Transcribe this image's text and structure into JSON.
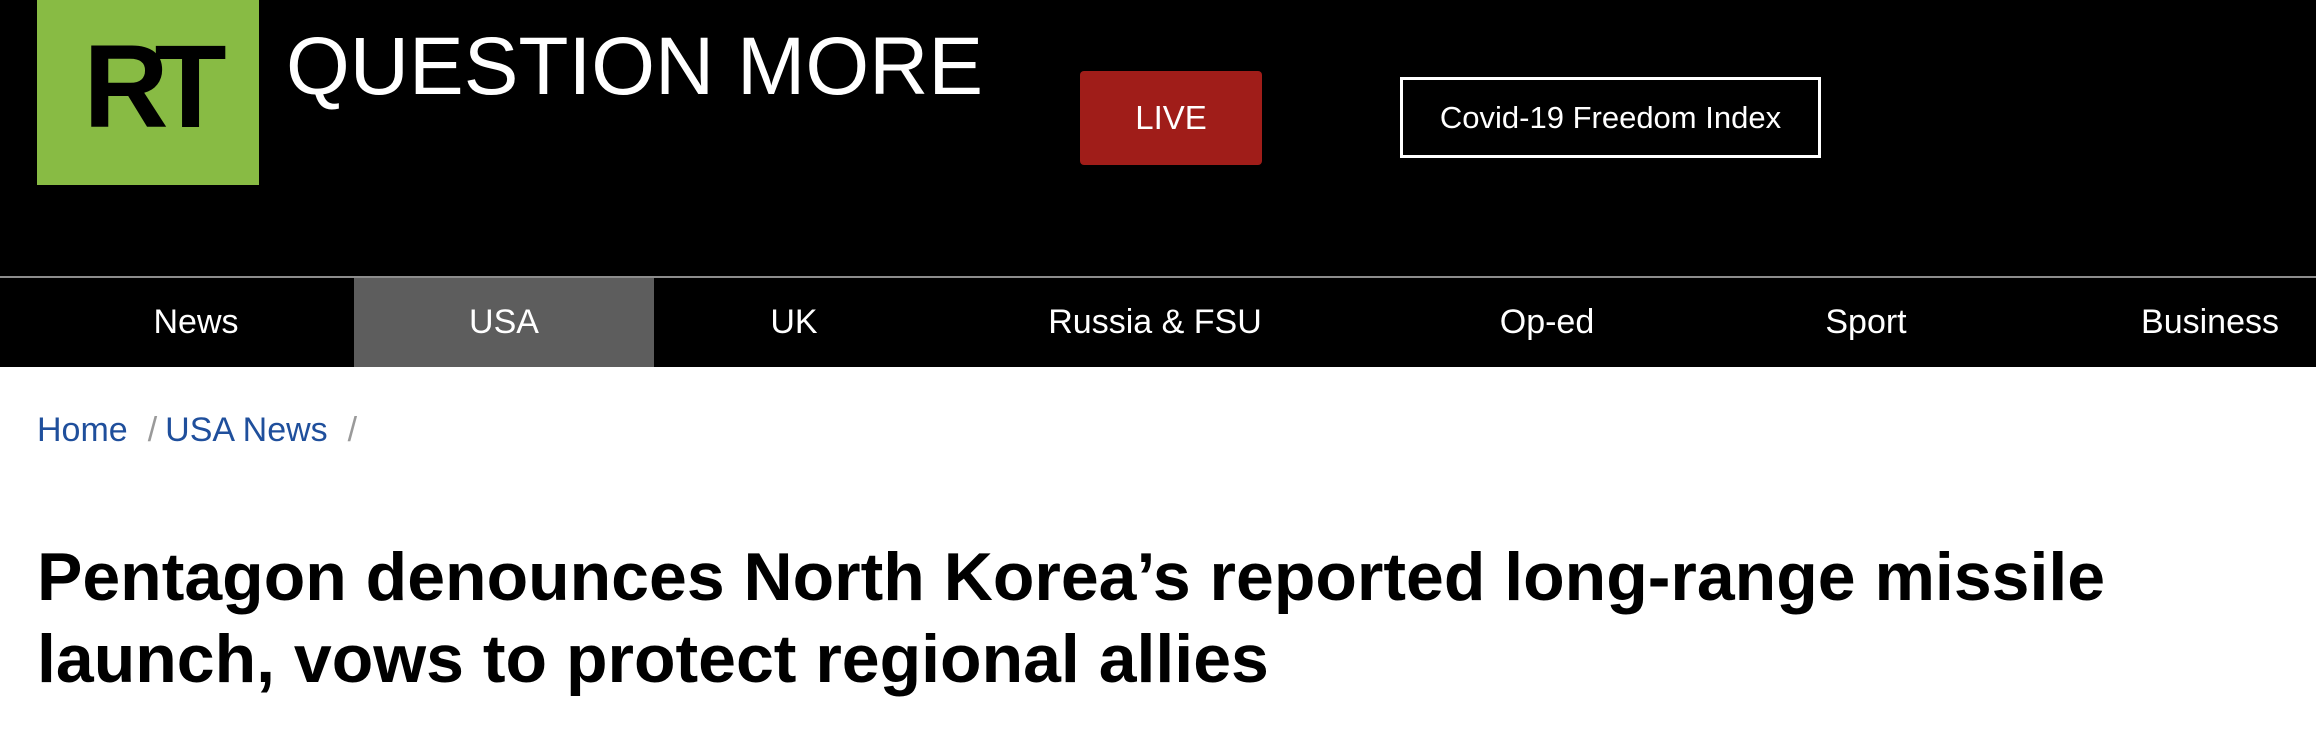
{
  "header": {
    "logo_text": "RT",
    "tagline": "QUESTION MORE",
    "live_label": "LIVE",
    "covid_label": "Covid-19 Freedom Index"
  },
  "colors": {
    "logo_green": "#88bb44",
    "live_red": "#a01d19",
    "nav_active": "#5d5d5d",
    "link_blue": "#1f4f9c"
  },
  "nav": {
    "items": [
      {
        "label": "News",
        "active": false
      },
      {
        "label": "USA",
        "active": true
      },
      {
        "label": "UK",
        "active": false
      },
      {
        "label": "Russia & FSU",
        "active": false
      },
      {
        "label": "Op-ed",
        "active": false
      },
      {
        "label": "Sport",
        "active": false
      },
      {
        "label": "Business",
        "active": false
      }
    ]
  },
  "breadcrumb": {
    "items": [
      "Home",
      "USA News"
    ],
    "separator": "/"
  },
  "article": {
    "title": "Pentagon denounces North Korea’s reported long-range missile launch, vows to protect regional allies"
  }
}
